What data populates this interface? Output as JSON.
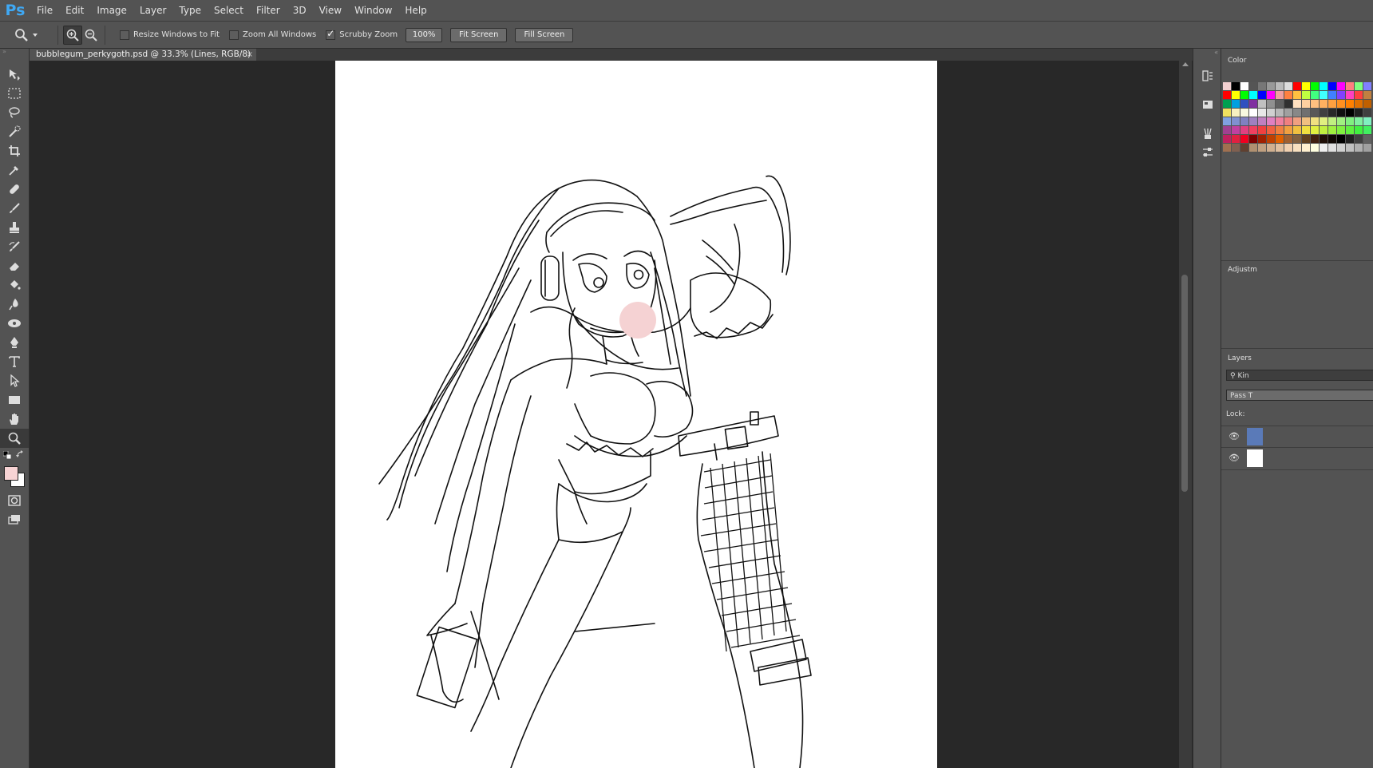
{
  "app": {
    "logo": "Ps"
  },
  "menu": [
    "File",
    "Edit",
    "Image",
    "Layer",
    "Type",
    "Select",
    "Filter",
    "3D",
    "View",
    "Window",
    "Help"
  ],
  "options": {
    "resize_windows": "Resize Windows to Fit",
    "zoom_all": "Zoom All Windows",
    "scrubby": "Scrubby Zoom",
    "btn_100": "100%",
    "btn_fit": "Fit Screen",
    "btn_fill": "Fill Screen"
  },
  "document": {
    "tab_title": "bubblegum_perkygoth.psd @ 33.3% (Lines, RGB/8) *",
    "close": "×"
  },
  "panels": {
    "color_tab": "Color",
    "adjust_tab": "Adjustm",
    "layers_tab": "Layers",
    "kind_label": "Kin",
    "pass_label": "Pass T",
    "lock_label": "Lock:"
  },
  "colors": {
    "foreground": "#f7d3d4",
    "background": "#ffffff",
    "bubble": "#f5d2d3",
    "accent": "#3fa9f5"
  },
  "swatches": [
    "#f2cfd0",
    "#000000",
    "#ffffff",
    "#555555",
    "#777777",
    "#999999",
    "#bbbbbb",
    "#dddddd",
    "#ff0000",
    "#ffff00",
    "#00ff00",
    "#00ffff",
    "#0000ff",
    "#ff00ff",
    "#ff8080",
    "#80ff80",
    "#8080ff",
    "#ff0000",
    "#ffff00",
    "#00ff00",
    "#00ffff",
    "#0000ff",
    "#ff00ff",
    "#f0a0a0",
    "#ff8040",
    "#ffc040",
    "#c0ff40",
    "#40ff80",
    "#40ffff",
    "#4080ff",
    "#8040ff",
    "#ff40c0",
    "#ff4040",
    "#c08040",
    "#00a050",
    "#00a0e0",
    "#3050c0",
    "#8030a0",
    "#c0c0c0",
    "#909090",
    "#606060",
    "#303030",
    "#ffe0c0",
    "#ffd0a0",
    "#ffc080",
    "#ffb060",
    "#ffa040",
    "#ff9020",
    "#ff8000",
    "#e07000",
    "#c06000",
    "#f0e060",
    "#f8f0c0",
    "#f8f8e0",
    "#ffffff",
    "#e8e8e8",
    "#d0d0d0",
    "#b8b8b8",
    "#a0a0a0",
    "#888888",
    "#707070",
    "#585858",
    "#404040",
    "#282828",
    "#101010",
    "#000000",
    "#202020",
    "#404040",
    "#80a0e0",
    "#8090d0",
    "#8080c0",
    "#a080c0",
    "#c080c0",
    "#e080c0",
    "#f080a0",
    "#f08080",
    "#f0a080",
    "#f0c080",
    "#f0e080",
    "#e0f080",
    "#c0f080",
    "#a0f080",
    "#80f080",
    "#80f0a0",
    "#80f0c0",
    "#a04090",
    "#c040a0",
    "#e04080",
    "#f04060",
    "#f04040",
    "#f06040",
    "#f08040",
    "#f0a040",
    "#f0c040",
    "#f0e040",
    "#e0f040",
    "#c0f040",
    "#a0f040",
    "#80f040",
    "#60f040",
    "#40f040",
    "#40f060",
    "#c02060",
    "#e02040",
    "#f00020",
    "#800000",
    "#a02000",
    "#c04000",
    "#e06000",
    "#a06030",
    "#806040",
    "#604020",
    "#402010",
    "#201008",
    "#100804",
    "#000000",
    "#202020",
    "#404040",
    "#606060",
    "#a07050",
    "#806050",
    "#604030",
    "#b09070",
    "#c0a080",
    "#d0b090",
    "#e0c0a0",
    "#f0d0b0",
    "#f8e0c0",
    "#fff0d0",
    "#ffffe0",
    "#f0f0f0",
    "#e0e0e0",
    "#d0d0d0",
    "#c0c0c0",
    "#b0b0b0",
    "#a0a0a0"
  ]
}
